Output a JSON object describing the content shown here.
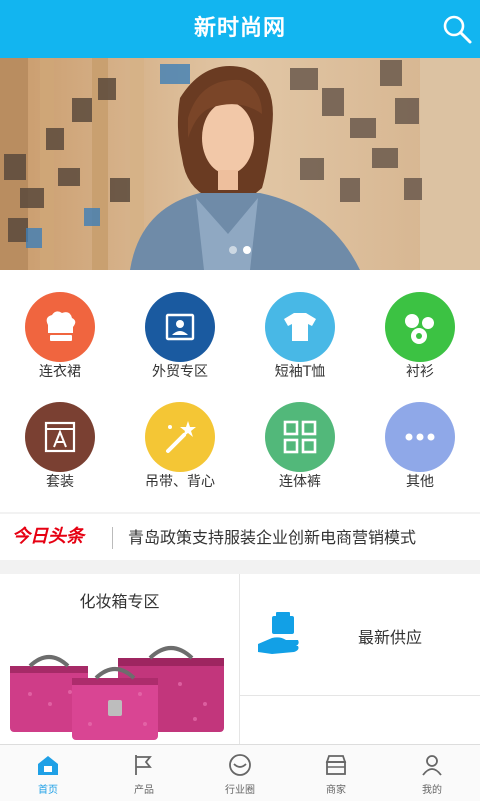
{
  "header": {
    "title": "新时尚网",
    "search_icon": "search-icon"
  },
  "banner": {
    "slides": 2,
    "active_slide": 2
  },
  "categories": [
    {
      "label": "连衣裙",
      "icon": "chef-hat-icon",
      "color": "#f0653f"
    },
    {
      "label": "外贸专区",
      "icon": "id-card-icon",
      "color": "#1a5aa0"
    },
    {
      "label": "短袖T恤",
      "icon": "tshirt-icon",
      "color": "#48b8e6"
    },
    {
      "label": "衬衫",
      "icon": "bubbles-icon",
      "color": "#3cc243"
    },
    {
      "label": "套装",
      "icon": "text-frame-icon",
      "color": "#7a4032"
    },
    {
      "label": "吊带、背心",
      "icon": "magic-wand-icon",
      "color": "#f4c635"
    },
    {
      "label": "连体裤",
      "icon": "grid-icon",
      "color": "#52b87a"
    },
    {
      "label": "其他",
      "icon": "more-icon",
      "color": "#8fa8e8"
    }
  ],
  "news": {
    "badge": "今日头条",
    "headline": "青岛政策支持服装企业创新电商营销模式"
  },
  "promo": {
    "left_title": "化妆箱专区",
    "right_title": "最新供应",
    "right_icon": "hand-box-icon"
  },
  "tabbar": [
    {
      "label": "首页",
      "icon": "home-icon",
      "active": true
    },
    {
      "label": "产品",
      "icon": "flag-icon",
      "active": false
    },
    {
      "label": "行业圈",
      "icon": "smile-circle-icon",
      "active": false
    },
    {
      "label": "商家",
      "icon": "store-icon",
      "active": false
    },
    {
      "label": "我的",
      "icon": "user-icon",
      "active": false
    }
  ],
  "colors": {
    "brand": "#12b5f0",
    "headline_red": "#e60012",
    "tab_active": "#1fa0e6"
  }
}
